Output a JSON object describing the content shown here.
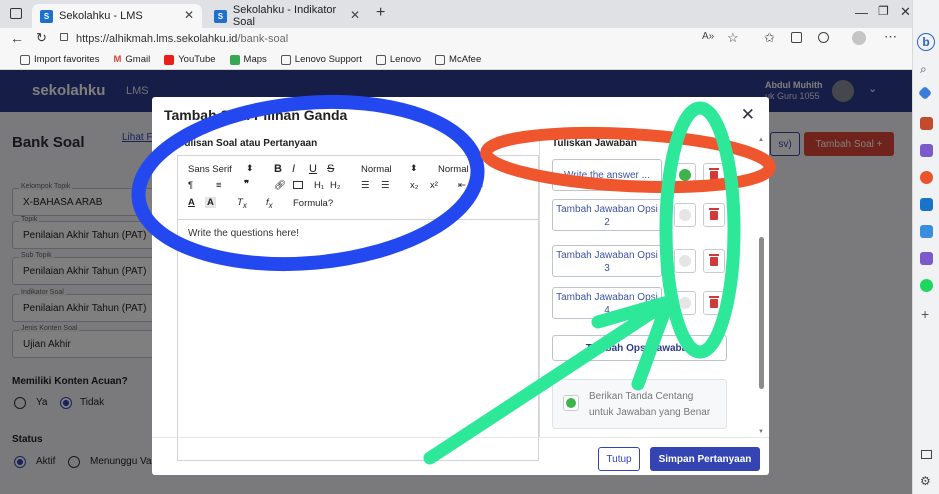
{
  "browser": {
    "tabs": [
      {
        "title": "Sekolahku - LMS",
        "active": true
      },
      {
        "title": "Sekolahku - Indikator Soal",
        "active": false
      }
    ],
    "new_tab_label": "+",
    "url_main": "https://alhikmah.lms.sekolahku.id",
    "url_path": "/bank-soal",
    "favorites": [
      "Import favorites",
      "Gmail",
      "YouTube",
      "Maps",
      "Lenovo Support",
      "Lenovo",
      "McAfee"
    ]
  },
  "app": {
    "logo": "sekolahku",
    "nav_item": "LMS",
    "user_name": "Abdul Muhith",
    "user_role": "uk Guru 1055"
  },
  "page": {
    "title": "Bank Soal",
    "link": "Lihat F",
    "btn_csv": "sv)",
    "btn_add": "Tambah Soal +",
    "fields": [
      {
        "label": "Kelompok Topik",
        "value": "X-BAHASA ARAB"
      },
      {
        "label": "Topik",
        "value": "Penilaian Akhir Tahun (PAT)"
      },
      {
        "label": "Sub Topik",
        "value": "Penilaian Akhir Tahun (PAT)"
      },
      {
        "label": "Indikator Soal",
        "value": "Penilaian Akhir Tahun (PAT)"
      },
      {
        "label": "Jenis Konten Soal",
        "value": "Ujian Akhir"
      }
    ],
    "reference_label": "Memiliki Konten Acuan?",
    "reference_options": [
      "Ya",
      "Tidak"
    ],
    "status_label": "Status",
    "status_options": [
      "Aktif",
      "Menunggu Va"
    ]
  },
  "modal": {
    "title": "Tambah Soal Pilihan Ganda",
    "question_heading": "Tulisan Soal atau Pertanyaan",
    "toolbar": {
      "font": "Sans Serif",
      "size1": "Normal",
      "size2": "Normal",
      "formula": "Formula?"
    },
    "question_placeholder": "Write the questions here!",
    "answer_heading": "Tuliskan Jawaban",
    "answers": [
      {
        "text": "Write the answer ...",
        "correct": true
      },
      {
        "text": "Tambah Jawaban Opsi 2",
        "correct": false
      },
      {
        "text": "Tambah Jawaban Opsi 3",
        "correct": false
      },
      {
        "text": "Tambah Jawaban Opsi 4",
        "correct": false
      }
    ],
    "add_option_label": "Tambah Opsi Jawaban",
    "hint_text": "Berikan Tanda Centang untuk Jawaban yang Benar",
    "btn_close": "Tutup",
    "btn_save": "Simpan Pertanyaan"
  },
  "colors": {
    "header": "#2d3a8c",
    "primary": "#3445b3",
    "danger": "#e0443b",
    "check": "#3cb44b",
    "annot_blue": "#2448ef",
    "annot_red": "#f0562e",
    "annot_green": "#2ee89a"
  }
}
